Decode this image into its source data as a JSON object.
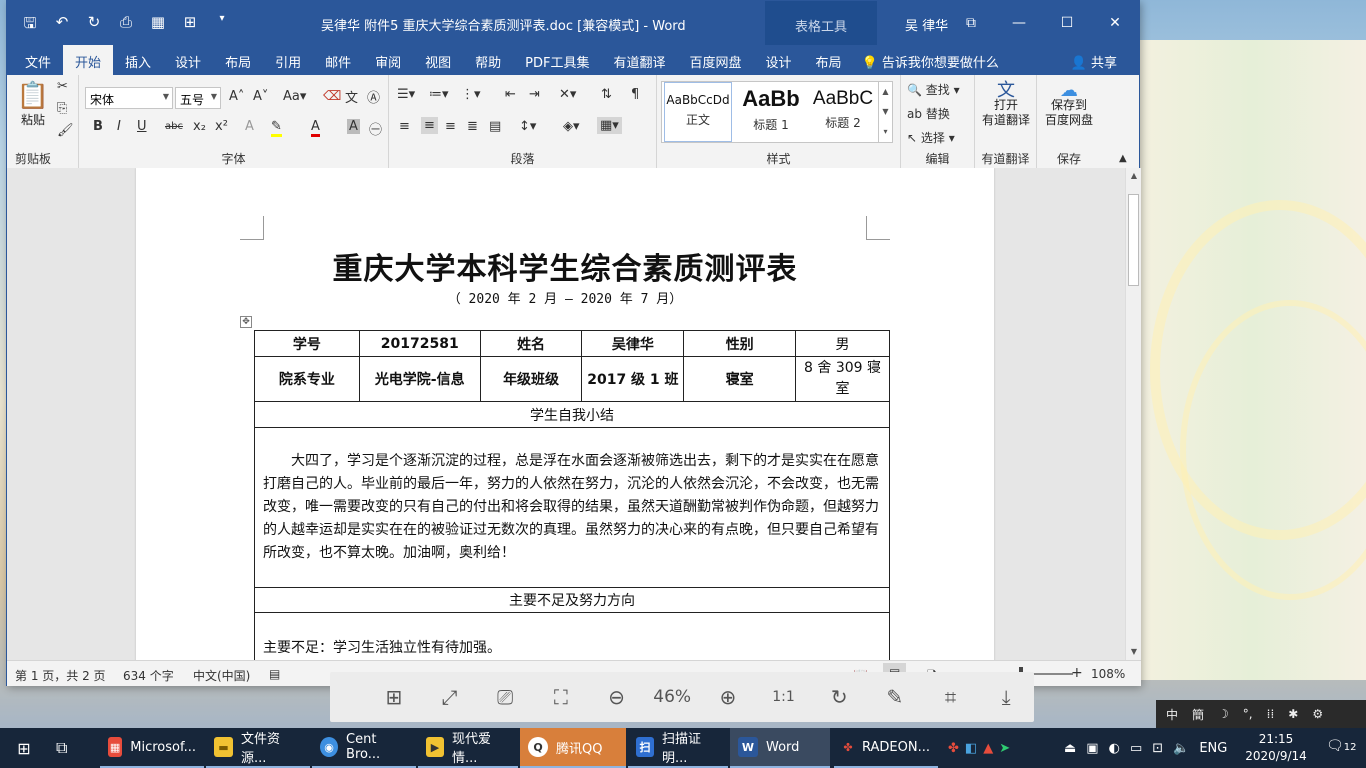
{
  "titlebar": {
    "title": "吴律华 附件5 重庆大学综合素质测评表.doc [兼容模式]  -  Word",
    "table_tools": "表格工具",
    "user": "吴 律华",
    "quick_icons": [
      "save-icon",
      "undo-icon",
      "redo-icon",
      "print-preview-icon",
      "table-icon",
      "grid-icon",
      "customize-icon"
    ]
  },
  "menu": {
    "items": [
      "文件",
      "开始",
      "插入",
      "设计",
      "布局",
      "引用",
      "邮件",
      "审阅",
      "视图",
      "帮助",
      "PDF工具集",
      "有道翻译",
      "百度网盘",
      "设计",
      "布局"
    ],
    "active": "开始",
    "tell_me": "告诉我你想要做什么",
    "share": "共享"
  },
  "ribbon": {
    "clipboard": {
      "paste": "粘贴",
      "label": "剪贴板"
    },
    "font": {
      "name": "宋体",
      "size": "五号",
      "label": "字体",
      "buttons": [
        "B",
        "I",
        "U",
        "abc",
        "x₂",
        "x²"
      ]
    },
    "paragraph": {
      "label": "段落"
    },
    "styles": {
      "label": "样式",
      "items": [
        {
          "preview": "AaBbCcDd",
          "name": "正文"
        },
        {
          "preview": "AaBb",
          "name": "标题 1"
        },
        {
          "preview": "AaBbC",
          "name": "标题 2"
        }
      ]
    },
    "editing": {
      "find": "查找",
      "replace": "替换",
      "select": "选择",
      "label": "编辑"
    },
    "youdao": {
      "btn": "打开\n有道翻译",
      "line1": "打开",
      "line2": "有道翻译",
      "label": "有道翻译"
    },
    "baidu": {
      "line1": "保存到",
      "line2": "百度网盘",
      "label": "保存"
    }
  },
  "document": {
    "title": "重庆大学本科学生综合素质测评表",
    "date_range": "（ 2020 年 2 月 — 2020 年 7 月）",
    "row1": [
      "学号",
      "20172581",
      "姓名",
      "吴律华",
      "性别",
      "男"
    ],
    "row2": [
      "院系专业",
      "光电学院-信息",
      "年级班级",
      "2017 级 1 班",
      "寝室",
      "8 舍 309 寝室"
    ],
    "section1": "学生自我小结",
    "summary": "大四了，学习是个逐渐沉淀的过程，总是浮在水面会逐渐被筛选出去，剩下的才是实实在在愿意打磨自己的人。毕业前的最后一年，努力的人依然在努力，沉沦的人依然会沉沦，不会改变，也无需改变，唯一需要改变的只有自己的付出和将会取得的结果，虽然天道酬勤常被判作伪命题，但越努力的人越幸运却是实实在在的被验证过无数次的真理。虽然努力的决心来的有点晚，但只要自己希望有所改变，也不算太晚。加油啊，奥利给！",
    "section2": "主要不足及努力方向",
    "shortcoming": "主要不足：学习生活独立性有待加强。"
  },
  "statusbar": {
    "page": "第 1 页，共 2 页",
    "words": "634 个字",
    "language": "中文(中国)",
    "zoom": "108%"
  },
  "viewer": {
    "zoom": "46%",
    "icons": [
      "thumbnails-icon",
      "fit-icon",
      "screenshot-icon",
      "fullscreen-icon",
      "zoom-out-icon",
      "zoom-in-icon",
      "actual-size-icon",
      "rotate-icon",
      "edit-icon",
      "crop-icon",
      "download-icon"
    ]
  },
  "tray_popup": [
    "中",
    "簡"
  ],
  "taskbar": {
    "apps": [
      {
        "label": "Microsof...",
        "color": "#e74c3c"
      },
      {
        "label": "文件资源...",
        "color": "#f1c232"
      },
      {
        "label": "Cent Bro...",
        "color": "#3d8fe0"
      },
      {
        "label": "现代爱情...",
        "color": "#f1c232"
      },
      {
        "label": "腾讯QQ",
        "color": "#d87f3b"
      },
      {
        "label": "扫描证明...",
        "color": "#2f6fd1"
      },
      {
        "label": "Word",
        "color": "#2b579a"
      },
      {
        "label": "RADEON...",
        "color": "#c0392b"
      }
    ],
    "lang": "ENG",
    "time": "21:15",
    "date": "2020/9/14",
    "notif_count": "12"
  }
}
